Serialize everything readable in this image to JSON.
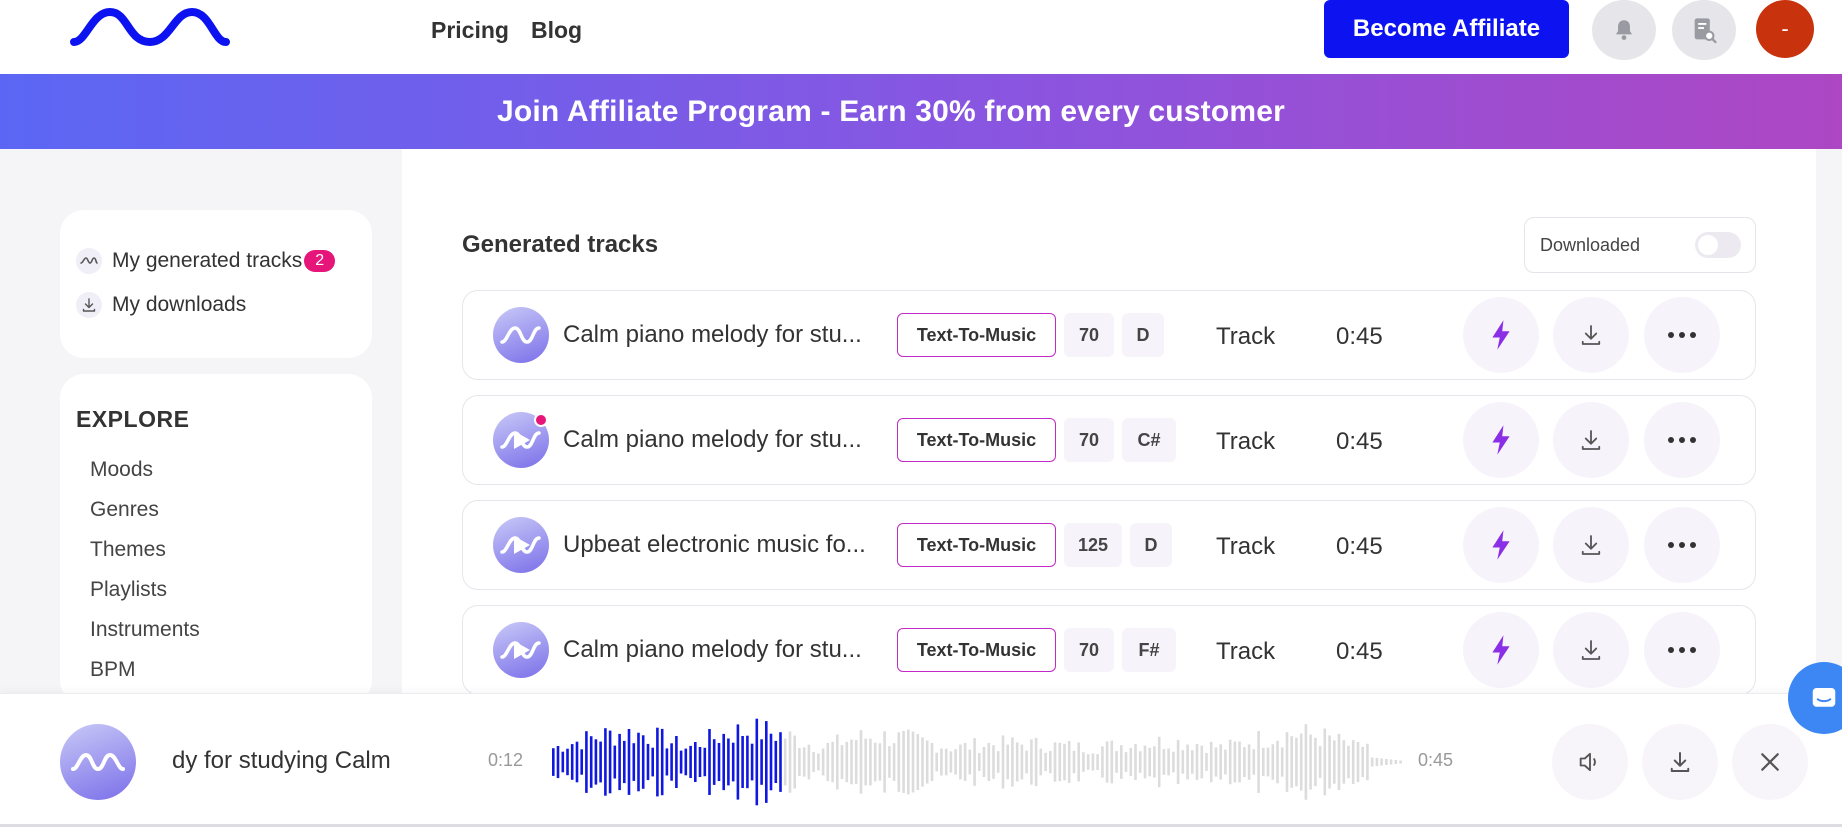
{
  "header": {
    "nav": [
      "Pricing",
      "Blog"
    ],
    "affiliate_button": "Become Affiliate",
    "avatar_initial": "-",
    "icons": [
      "logo-wave-icon",
      "bell-icon",
      "document-search-icon"
    ]
  },
  "banner": {
    "text": "Join Affiliate Program - Earn 30% from every customer"
  },
  "sidebar": {
    "items": [
      {
        "label": "My generated tracks",
        "badge": "2",
        "icon": "wave-icon"
      },
      {
        "label": "My downloads",
        "icon": "download-icon"
      }
    ],
    "explore": {
      "title": "EXPLORE",
      "items": [
        "Moods",
        "Genres",
        "Themes",
        "Playlists",
        "Instruments",
        "BPM"
      ]
    }
  },
  "main": {
    "title": "Generated tracks",
    "downloaded_toggle": {
      "label": "Downloaded",
      "on": false
    },
    "tracks": [
      {
        "title": "Calm piano melody for stu...",
        "tag": "Text-To-Music",
        "bpm": "70",
        "key": "D",
        "type": "Track",
        "duration": "0:45",
        "new": false
      },
      {
        "title": "Calm piano melody for stu...",
        "tag": "Text-To-Music",
        "bpm": "70",
        "key": "C#",
        "type": "Track",
        "duration": "0:45",
        "new": true
      },
      {
        "title": "Upbeat electronic music fo...",
        "tag": "Text-To-Music",
        "bpm": "125",
        "key": "D",
        "type": "Track",
        "duration": "0:45",
        "new": false
      },
      {
        "title": "Calm piano melody for stu...",
        "tag": "Text-To-Music",
        "bpm": "70",
        "key": "F#",
        "type": "Track",
        "duration": "0:45",
        "new": false
      }
    ]
  },
  "player": {
    "title": "dy for studying  Calm",
    "current_time": "0:12",
    "total_time": "0:45",
    "progress": 0.27
  },
  "colors": {
    "accent": "#0c13f0",
    "banner_start": "#5b67f4",
    "banner_end": "#ad47c4",
    "tag_border": "#c22bc9",
    "bolt": "#8b2fe6",
    "badge": "#e6157a",
    "avatar": "#c8330e",
    "wave_played": "#1018e0",
    "wave_unplayed": "#dcdcdc"
  }
}
